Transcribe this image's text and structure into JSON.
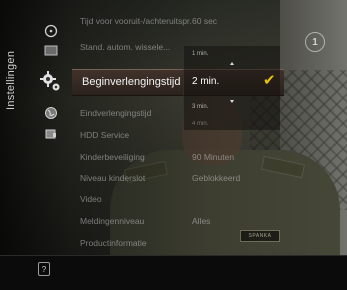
{
  "sidebar": {
    "title": "Instellingen"
  },
  "categories": [
    {
      "icon": "clock-icon"
    },
    {
      "icon": "tv-screen-icon"
    },
    {
      "icon": "gear-icon"
    },
    {
      "icon": "globe-icon"
    },
    {
      "icon": "pin-lock-icon"
    }
  ],
  "settings": {
    "rows": [
      {
        "label": "Tijd voor vooruit-/achteruitspr...:",
        "value": "60 sec"
      },
      {
        "label": "Stand. autom. wissele...",
        "value": ""
      },
      {
        "label": "Eindverlengingstijd",
        "value": ""
      },
      {
        "label": "HDD Service",
        "value": ""
      },
      {
        "label": "Kinderbeveiliging",
        "value": "90 Minuten"
      },
      {
        "label": "Niveau kinderslot",
        "value": "Geblokkeerd"
      },
      {
        "label": "Video",
        "value": ""
      },
      {
        "label": "Meldingenniveau",
        "value": "Alles"
      },
      {
        "label": "Productinformatie",
        "value": ""
      }
    ],
    "selected_label": "Beginverlengingstijd"
  },
  "popup": {
    "options": [
      "1 min.",
      "2 min.",
      "3 min.",
      "4 min."
    ],
    "selected": "2 min.",
    "check_icon": "checkmark-icon"
  },
  "channel_logo": {
    "text": "1"
  },
  "bottom_bar": {
    "help_icon": "help-icon",
    "help_text": "?"
  },
  "colors": {
    "check": "#e8c200",
    "selection": "#40322a"
  }
}
